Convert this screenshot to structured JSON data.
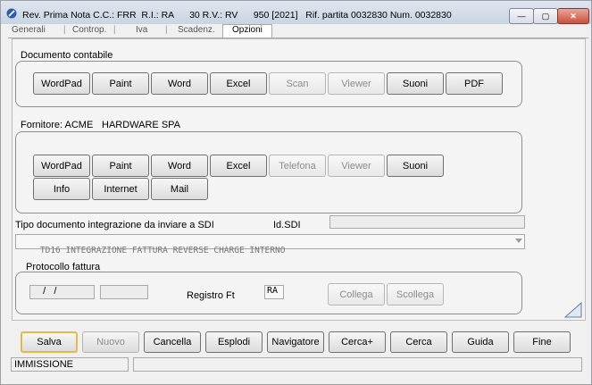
{
  "window": {
    "title": "Rev. Prima Nota C.C.: FRR  R.I.: RA      30 R.V.: RV      950 [2021]   Rif. partita 0032830 Num. 0032830",
    "controls": {
      "minimize": "—",
      "restore": "▢",
      "close": "✕"
    }
  },
  "tabs": [
    {
      "label": "Generali"
    },
    {
      "label": "Controp."
    },
    {
      "label": "Iva"
    },
    {
      "label": "Scadenz."
    },
    {
      "label": "Opzioni"
    }
  ],
  "documento": {
    "title": "Documento contabile",
    "buttons": [
      {
        "label": "WordPad",
        "enabled": true
      },
      {
        "label": "Paint",
        "enabled": true
      },
      {
        "label": "Word",
        "enabled": true
      },
      {
        "label": "Excel",
        "enabled": true
      },
      {
        "label": "Scan",
        "enabled": false
      },
      {
        "label": "Viewer",
        "enabled": false
      },
      {
        "label": "Suoni",
        "enabled": true
      },
      {
        "label": "PDF",
        "enabled": true
      }
    ]
  },
  "fornitore": {
    "label": "Fornitore: ACME",
    "name": "HARDWARE SPA",
    "buttons_row1": [
      {
        "label": "WordPad",
        "enabled": true
      },
      {
        "label": "Paint",
        "enabled": true
      },
      {
        "label": "Word",
        "enabled": true
      },
      {
        "label": "Excel",
        "enabled": true
      },
      {
        "label": "Telefona",
        "enabled": false
      },
      {
        "label": "Viewer",
        "enabled": false
      },
      {
        "label": "Suoni",
        "enabled": true
      }
    ],
    "buttons_row2": [
      {
        "label": "Info",
        "enabled": true
      },
      {
        "label": "Internet",
        "enabled": true
      },
      {
        "label": "Mail",
        "enabled": true
      }
    ]
  },
  "sdi": {
    "label": "Tipo documento integrazione da inviare a SDI",
    "id_label": "Id.SDI",
    "id_value": "",
    "selected": "TD16 INTEGRAZIONE FATTURA REVERSE CHARGE INTERNO"
  },
  "protocollo": {
    "title": "Protocollo fattura",
    "date_value": "  /   /",
    "number_value": "",
    "registro_label": "Registro Ft",
    "registro_value": "RA",
    "collega_label": "Collega",
    "scollega_label": "Scollega"
  },
  "footer": {
    "buttons": [
      {
        "label": "Salva",
        "enabled": true
      },
      {
        "label": "Nuovo",
        "enabled": false
      },
      {
        "label": "Cancella",
        "enabled": true
      },
      {
        "label": "Esplodi",
        "enabled": true
      },
      {
        "label": "Navigatore",
        "enabled": true
      },
      {
        "label": "Cerca+",
        "enabled": true
      },
      {
        "label": "Cerca",
        "enabled": true
      },
      {
        "label": "Guida",
        "enabled": true
      },
      {
        "label": "Fine",
        "enabled": true
      }
    ],
    "status_mode": "IMMISSIONE",
    "status_message": ""
  }
}
